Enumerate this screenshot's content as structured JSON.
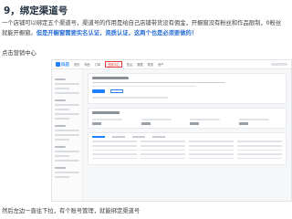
{
  "heading": "9，绑定渠道号",
  "paragraph": {
    "normal": "一个店铺可以绑定五个渠道号，渠道号的作用是给自己店铺带货没有佣金，开橱窗没有粉丝和作品限制，0粉丝就能开橱窗。",
    "highlight": "但是开橱窗需要实名认证，资质认证，这两个也是必须要做的！"
  },
  "sub_caption": "点击营销中心",
  "footer_caption": "然后左边一直往下拉，有个账号管理，就能绑定渠道号",
  "screenshot": {
    "logo": "抖店",
    "nav": [
      "首页",
      "商品",
      "订单",
      "营销中心",
      "售后",
      "数据",
      "物流",
      "资产"
    ],
    "active_nav": "营销中心"
  },
  "colors": {
    "highlight": "#2a6fd6",
    "active_border": "#e53935",
    "brand": "#1e80ff"
  }
}
